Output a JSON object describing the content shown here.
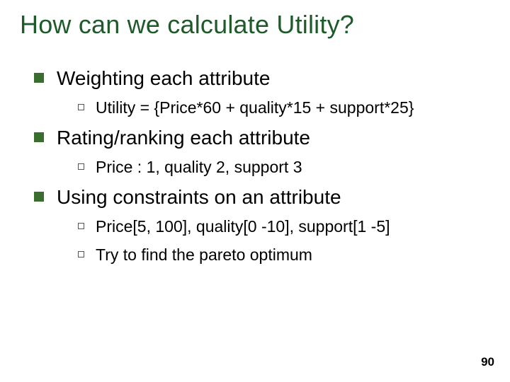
{
  "title": "How can we calculate Utility?",
  "sections": [
    {
      "heading": "Weighting each attribute",
      "subs": [
        "Utility = {Price*60 + quality*15 + support*25}"
      ]
    },
    {
      "heading": "Rating/ranking each attribute",
      "subs": [
        "Price : 1, quality 2, support 3"
      ]
    },
    {
      "heading": "Using constraints on an attribute",
      "subs": [
        "Price[5, 100], quality[0 -10], support[1 -5]",
        "Try to find the pareto optimum"
      ]
    }
  ],
  "page_number": "90"
}
